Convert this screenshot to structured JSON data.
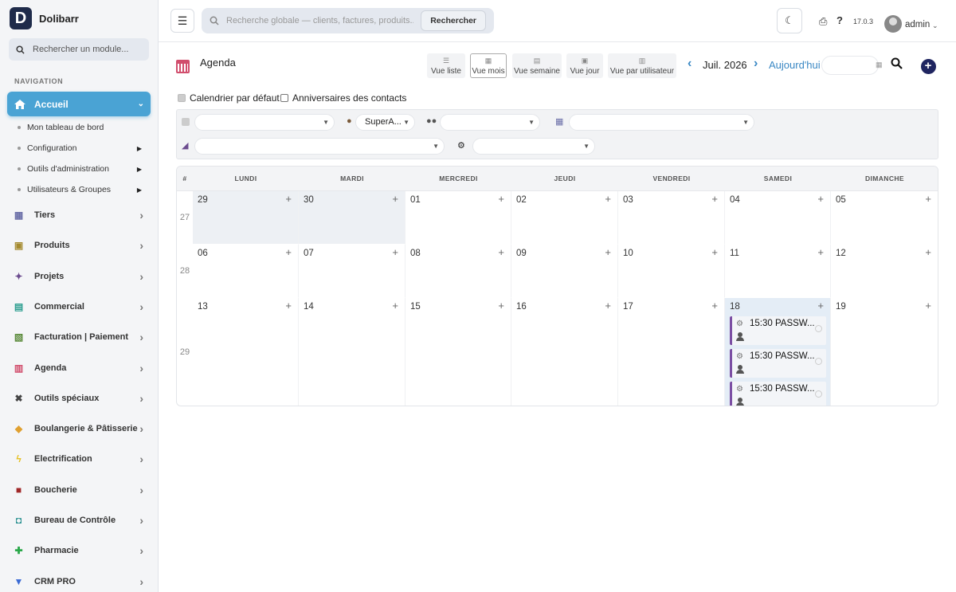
{
  "app": {
    "name": "Dolibarr",
    "logo_letter": "D"
  },
  "sidebar": {
    "search_placeholder": "Rechercher un module...",
    "nav_title": "NAVIGATION",
    "active": {
      "label": "Accueil",
      "icon": "home-icon"
    },
    "subs": [
      {
        "label": "Mon tableau de bord",
        "arrow": false
      },
      {
        "label": "Configuration",
        "arrow": true
      },
      {
        "label": "Outils d'administration",
        "arrow": true
      },
      {
        "label": "Utilisateurs & Groupes",
        "arrow": true
      }
    ],
    "items": [
      {
        "label": "Tiers",
        "icon": "building-icon",
        "color": "#6b6fa8"
      },
      {
        "label": "Produits",
        "icon": "cube-icon",
        "color": "#a48a2f"
      },
      {
        "label": "Projets",
        "icon": "project-icon",
        "color": "#6c4c8f"
      },
      {
        "label": "Commercial",
        "icon": "briefcase-icon",
        "color": "#2a9d8f"
      },
      {
        "label": "Facturation | Paiement",
        "icon": "invoice-icon",
        "color": "#5a8a3a"
      },
      {
        "label": "Agenda",
        "icon": "calendar-icon",
        "color": "#d14e6d"
      },
      {
        "label": "Outils spéciaux",
        "icon": "tools-icon",
        "color": "#444444"
      },
      {
        "label": "Boulangerie & Pâtisserie",
        "icon": "bread-icon",
        "color": "#e0a030"
      },
      {
        "label": "Electrification",
        "icon": "bolt-icon",
        "color": "#e6c020"
      },
      {
        "label": "Boucherie",
        "icon": "meat-icon",
        "color": "#a02828"
      },
      {
        "label": "Bureau de Contrôle",
        "icon": "shield-icon",
        "color": "#1d8a8a"
      },
      {
        "label": "Pharmacie",
        "icon": "cross-icon",
        "color": "#2aa84a"
      },
      {
        "label": "CRM PRO",
        "icon": "filter-icon",
        "color": "#3a6ad4"
      }
    ]
  },
  "topbar": {
    "search_placeholder": "Recherche globale — clients, factures, produits...",
    "search_button": "Rechercher",
    "version": "17.0.3",
    "user": "admin"
  },
  "agenda": {
    "title": "Agenda",
    "views": [
      "Vue liste",
      "Vue mois",
      "Vue semaine",
      "Vue jour",
      "Vue par utilisateur"
    ],
    "active_view": "Vue mois",
    "month": "Juil. 2026",
    "today": "Aujourd'hui",
    "checkboxes": [
      {
        "label": "Calendrier par défaut",
        "checked": true
      },
      {
        "label": "Anniversaires des contacts",
        "checked": false
      }
    ],
    "filters": {
      "user_value": "SuperA..."
    },
    "week_header": "#",
    "day_headers": [
      "LUNDI",
      "MARDI",
      "MERCREDI",
      "JEUDI",
      "VENDREDI",
      "SAMEDI",
      "DIMANCHE"
    ],
    "weeks": [
      {
        "num": "27",
        "days": [
          "29",
          "30",
          "01",
          "02",
          "03",
          "04",
          "05"
        ]
      },
      {
        "num": "28",
        "days": [
          "06",
          "07",
          "08",
          "09",
          "10",
          "11",
          "12"
        ]
      },
      {
        "num": "29",
        "days": [
          "13",
          "14",
          "15",
          "16",
          "17",
          "18",
          "19"
        ]
      }
    ],
    "events": [
      {
        "label": "15:30 PASSW..."
      },
      {
        "label": "15:30 PASSW..."
      },
      {
        "label": "15:30 PASSW..."
      }
    ]
  }
}
